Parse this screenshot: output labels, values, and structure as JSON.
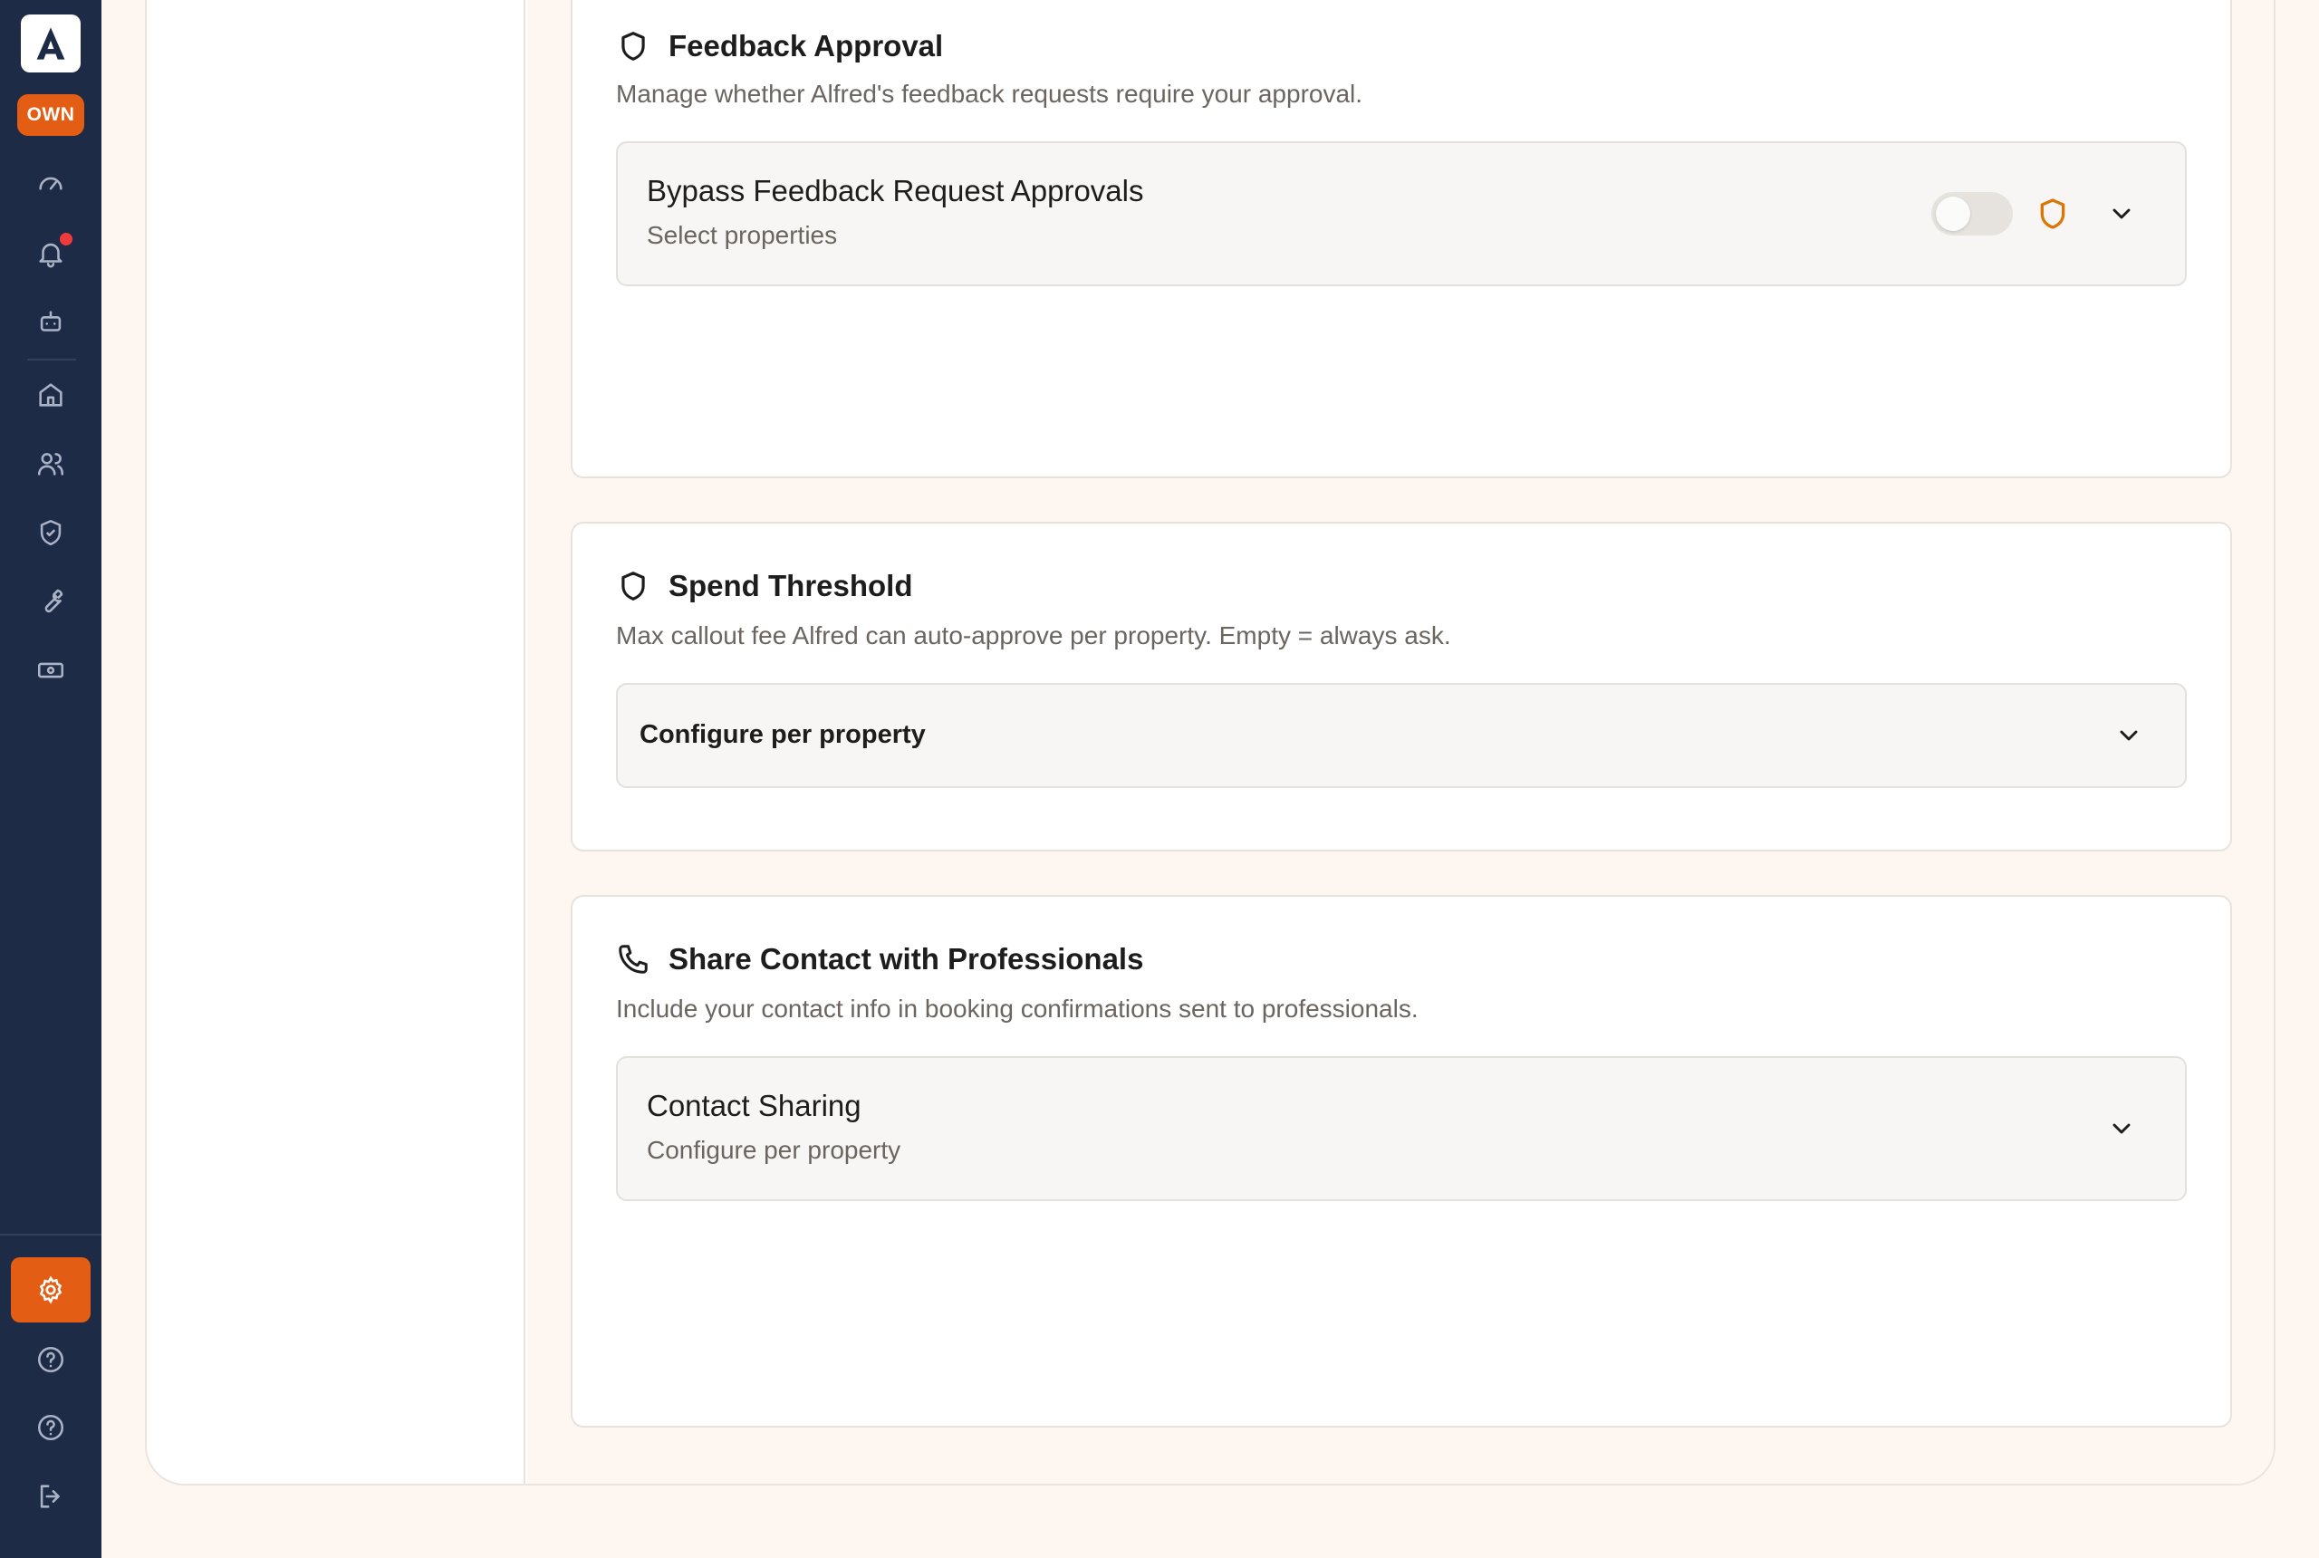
{
  "sidebar": {
    "logo_icon": "alfred-logo-icon",
    "badge": "OWN",
    "items": [
      {
        "icon": "dashboard-gauge-icon"
      },
      {
        "icon": "bell-icon",
        "has_notification": true
      },
      {
        "icon": "bot-icon"
      },
      {
        "icon": "home-icon"
      },
      {
        "icon": "users-icon"
      },
      {
        "icon": "shield-check-icon"
      },
      {
        "icon": "wrench-icon"
      },
      {
        "icon": "ticket-icon"
      }
    ],
    "bottom": [
      {
        "icon": "gear-icon",
        "active": true
      },
      {
        "icon": "help-circle-icon"
      },
      {
        "icon": "help-circle-icon"
      },
      {
        "icon": "logout-icon"
      }
    ],
    "accent_color": "#e35d14",
    "bg_color": "#1e2b47"
  },
  "sections": [
    {
      "icon": "shield-icon",
      "title": "Feedback Approval",
      "description": "Manage whether Alfred's feedback requests require your approval.",
      "row": {
        "title": "Bypass Feedback Request Approvals",
        "subtitle": "Select properties",
        "toggle_on": false
      }
    },
    {
      "icon": "shield-icon",
      "title": "Spend Threshold",
      "description": "Max callout fee Alfred can auto-approve per property. Empty = always ask.",
      "row": {
        "label": "Configure per property"
      }
    },
    {
      "icon": "phone-icon",
      "title": "Share Contact with Professionals",
      "description": "Include your contact info in booking confirmations sent to professionals.",
      "row": {
        "title": "Contact Sharing",
        "subtitle": "Configure per property"
      }
    }
  ]
}
